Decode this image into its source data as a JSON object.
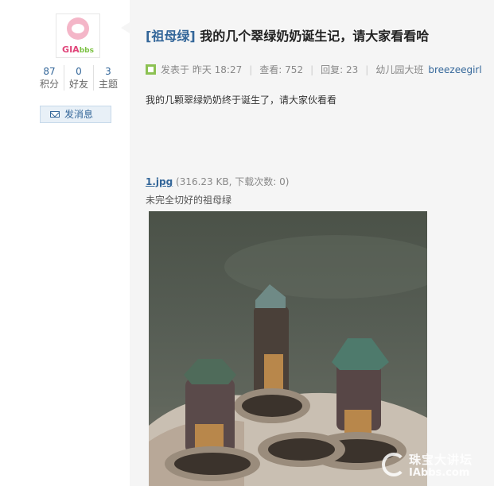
{
  "user": {
    "avatar_logo_main": "GIA",
    "avatar_logo_sub": "bbs",
    "stats": [
      {
        "num": "87",
        "label": "积分"
      },
      {
        "num": "0",
        "label": "好友"
      },
      {
        "num": "3",
        "label": "主题"
      }
    ],
    "message_button": "发消息"
  },
  "post": {
    "category": "[祖母绿]",
    "title": "我的几个翠绿奶奶诞生记，请大家看看哈",
    "posted_label": "发表于",
    "posted_time": "昨天 18:27",
    "views_label": "查看:",
    "views": "752",
    "replies_label": "回复:",
    "replies": "23",
    "board": "幼儿园大班",
    "author": "breezeegirl",
    "content": "我的几颗翠绿奶奶终于诞生了，请大家伙看看",
    "attachment": {
      "filename": "1.jpg",
      "info": " (316.23 KB, 下载次数: 0)",
      "caption": "未完全切好的祖母绿"
    }
  },
  "watermark": {
    "line1": "珠宝大讲坛",
    "line2": "IAbbs.com"
  }
}
